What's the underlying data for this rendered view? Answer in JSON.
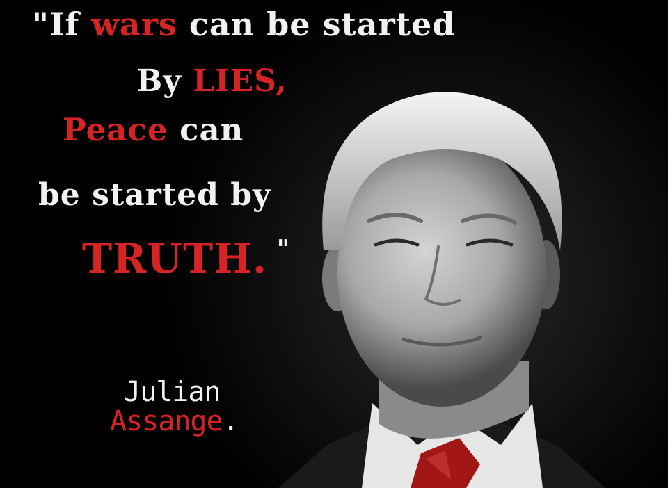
{
  "quote": {
    "line1": {
      "open": "\"If ",
      "red": "wars",
      "rest": " can be started"
    },
    "line2": {
      "lead": "By ",
      "red": "LIES,"
    },
    "line3": {
      "red": "Peace",
      "rest": " can"
    },
    "line4": {
      "text": "be started by"
    },
    "line5": {
      "red": "TRUTH.",
      "close": " \""
    }
  },
  "author": {
    "first_name": "Julian",
    "last_name": "Assange",
    "period": "."
  },
  "colors": {
    "background": "#000000",
    "white_text": "#f2f2f2",
    "red_text": "#d62323"
  },
  "icons": {
    "photo": "portrait-photo"
  }
}
